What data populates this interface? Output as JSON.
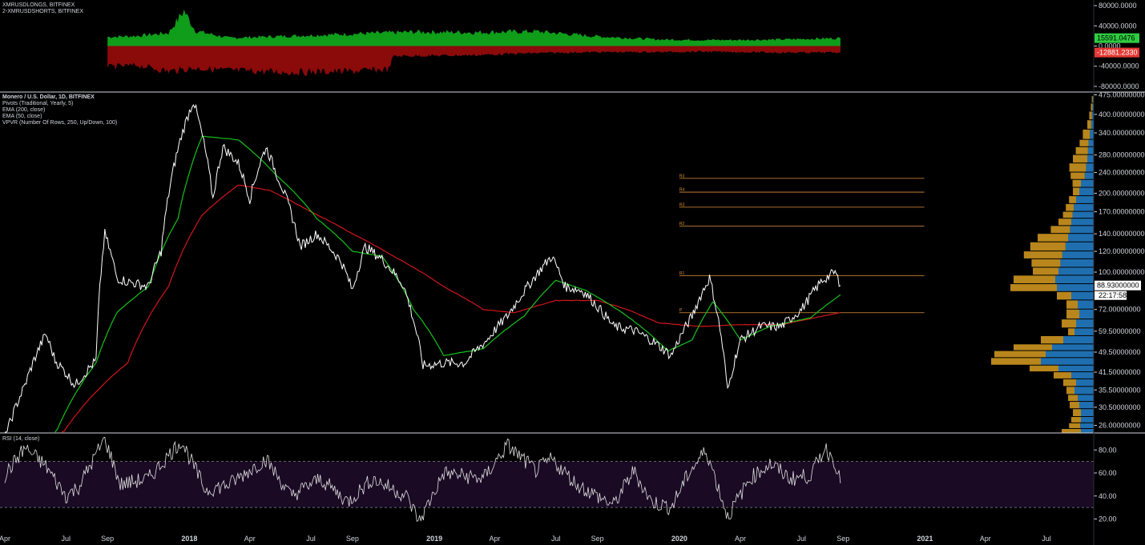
{
  "legends": {
    "top": [
      "XMRUSDLONGS, BITFINEX",
      "2-XMRUSDSHORTS, BITFINEX"
    ],
    "main": [
      "Monero / U.S. Dollar, 1D, BITFINEX",
      "Pivots (Traditional, Yearly, 5)",
      "EMA (200, close)",
      "EMA (50, close)",
      "VPVR (Number Of Rows, 250, Up/Down, 100)"
    ],
    "rsi": "RSI (14, close)"
  },
  "colors": {
    "longs": "#0f9d1a",
    "shorts": "#8b0a0a",
    "price": "#ffffff",
    "ema200": "#d3161b",
    "ema50": "#16c21a",
    "pivot": "#e0913a",
    "vpvr_up": "#1f6fb0",
    "vpvr_down": "#b8861c",
    "rsi_line": "#e0e0e0",
    "rsi_band": "#1a0a24",
    "badge_longs": "#2ecc40",
    "badge_shorts": "#e53935"
  },
  "chart_data": [
    {
      "id": "positions",
      "type": "area",
      "yticks": [
        "80000.0000",
        "40000.0000",
        "0.0000",
        "-40000.0000",
        "-80000.0000"
      ],
      "tick_values": [
        80000,
        40000,
        0,
        -40000,
        -80000
      ],
      "ylim": [
        -88000,
        88000
      ],
      "series": [
        {
          "name": "XMRUSDLONGS",
          "last_label": "15591.0476",
          "x": [
            "2017-09-01",
            "2017-10-15",
            "2017-12-01",
            "2017-12-24",
            "2018-01-10",
            "2018-03-01",
            "2018-06-01",
            "2018-09-01",
            "2018-12-01",
            "2019-03-01",
            "2019-06-01",
            "2019-09-01",
            "2019-12-01",
            "2020-02-01",
            "2020-04-01",
            "2020-06-01",
            "2020-08-28"
          ],
          "values": [
            18000,
            20000,
            26000,
            70000,
            30000,
            16000,
            20000,
            24000,
            28000,
            27000,
            29000,
            19000,
            13000,
            12000,
            12000,
            13000,
            15591
          ]
        },
        {
          "name": "XMRUSDSHORTS",
          "last_label": "-12881.2330",
          "x": [
            "2017-09-01",
            "2017-10-15",
            "2017-12-01",
            "2018-01-10",
            "2018-03-01",
            "2018-06-01",
            "2018-09-01",
            "2018-10-25",
            "2018-11-01",
            "2019-03-01",
            "2019-06-01",
            "2019-09-01",
            "2019-12-01",
            "2020-02-01",
            "2020-04-01",
            "2020-06-01",
            "2020-08-28"
          ],
          "values": [
            -42000,
            -38000,
            -50000,
            -44000,
            -48000,
            -52000,
            -50000,
            -46000,
            -20000,
            -18000,
            -14000,
            -12000,
            -12000,
            -11000,
            -12000,
            -13000,
            -12881
          ]
        }
      ]
    },
    {
      "id": "price",
      "type": "line",
      "scale": "log",
      "yticks": [
        "475.00000000",
        "400.00000000",
        "340.00000000",
        "280.00000000",
        "240.00000000",
        "200.00000000",
        "170.00000000",
        "140.00000000",
        "120.00000000",
        "100.00000000",
        "88.93000000",
        "72.00000000",
        "59.50000000",
        "49.50000000",
        "41.50000000",
        "35.50000000",
        "30.50000000",
        "26.00000000"
      ],
      "tick_values": [
        475,
        400,
        340,
        280,
        240,
        200,
        170,
        140,
        120,
        100,
        72,
        59.5,
        49.5,
        41.5,
        35.5,
        30.5,
        26
      ],
      "ylim": [
        24.5,
        480
      ],
      "last_price": 88.93,
      "last_price_label": "88.93000000",
      "countdown": "22:17:58",
      "pivots": [
        {
          "label": "R3",
          "value": 228
        },
        {
          "label": "R4",
          "value": 202
        },
        {
          "label": "R3",
          "value": 177
        },
        {
          "label": "R2",
          "value": 150
        },
        {
          "label": "R1",
          "value": 97
        },
        {
          "label": "P",
          "value": 70
        }
      ],
      "series": [
        {
          "name": "Monero / U.S. Dollar",
          "x": [
            "2017-04-01",
            "2017-05-01",
            "2017-06-01",
            "2017-06-15",
            "2017-07-15",
            "2017-08-15",
            "2017-08-28",
            "2017-09-15",
            "2017-10-01",
            "2017-11-01",
            "2017-11-20",
            "2017-12-20",
            "2018-01-07",
            "2018-02-05",
            "2018-02-20",
            "2018-03-15",
            "2018-04-01",
            "2018-04-25",
            "2018-05-10",
            "2018-06-15",
            "2018-07-10",
            "2018-08-15",
            "2018-09-01",
            "2018-09-20",
            "2018-10-15",
            "2018-11-15",
            "2018-12-15",
            "2019-01-15",
            "2019-02-15",
            "2019-03-20",
            "2019-04-20",
            "2019-05-20",
            "2019-06-25",
            "2019-07-15",
            "2019-08-10",
            "2019-09-25",
            "2019-10-25",
            "2019-11-20",
            "2019-12-20",
            "2020-01-20",
            "2020-02-15",
            "2020-03-13",
            "2020-04-01",
            "2020-05-01",
            "2020-06-01",
            "2020-07-01",
            "2020-08-01",
            "2020-08-20",
            "2020-08-28"
          ],
          "values": [
            23,
            37,
            58,
            46,
            37,
            46,
            140,
            95,
            92,
            88,
            120,
            330,
            450,
            190,
            300,
            260,
            190,
            300,
            240,
            125,
            140,
            110,
            85,
            125,
            112,
            90,
            44,
            45,
            45,
            55,
            68,
            88,
            115,
            88,
            85,
            62,
            60,
            55,
            48,
            68,
            95,
            35,
            55,
            62,
            62,
            72,
            93,
            100,
            88.93
          ]
        },
        {
          "name": "EMA (50, close)",
          "x": [
            "2017-06-15",
            "2017-08-15",
            "2017-09-15",
            "2017-11-01",
            "2017-12-15",
            "2018-01-20",
            "2018-03-15",
            "2018-05-10",
            "2018-07-10",
            "2018-09-01",
            "2018-10-15",
            "2018-12-01",
            "2019-01-15",
            "2019-03-15",
            "2019-05-15",
            "2019-07-01",
            "2019-08-15",
            "2019-10-15",
            "2019-12-15",
            "2020-01-20",
            "2020-02-20",
            "2020-04-01",
            "2020-05-15",
            "2020-07-15",
            "2020-08-28"
          ],
          "values": [
            24,
            45,
            70,
            88,
            160,
            330,
            320,
            235,
            160,
            120,
            115,
            72,
            48,
            51,
            68,
            93,
            85,
            68,
            50,
            55,
            77,
            55,
            62,
            67,
            82
          ]
        },
        {
          "name": "EMA (200, close)",
          "x": [
            "2017-06-25",
            "2017-10-01",
            "2017-12-01",
            "2018-01-20",
            "2018-03-15",
            "2018-05-01",
            "2018-07-01",
            "2018-09-01",
            "2018-11-01",
            "2019-01-15",
            "2019-03-15",
            "2019-05-01",
            "2019-07-01",
            "2019-09-01",
            "2019-10-15",
            "2019-12-01",
            "2020-02-01",
            "2020-04-01",
            "2020-06-01",
            "2020-08-28"
          ],
          "values": [
            24,
            45,
            88,
            165,
            215,
            205,
            170,
            140,
            115,
            88,
            72,
            70,
            78,
            78,
            72,
            64,
            62,
            63,
            63,
            70
          ]
        }
      ]
    },
    {
      "id": "rsi",
      "type": "line",
      "yticks": [
        "80.00",
        "60.00",
        "40.00",
        "20.00"
      ],
      "tick_values": [
        80,
        60,
        40,
        20
      ],
      "ylim": [
        12,
        92
      ],
      "band": [
        30,
        70
      ],
      "series": [
        {
          "name": "RSI (14, close)",
          "x": [
            "2017-04-01",
            "2017-05-01",
            "2017-06-01",
            "2017-07-01",
            "2017-07-20",
            "2017-08-28",
            "2017-09-20",
            "2017-11-01",
            "2017-12-20",
            "2018-01-25",
            "2018-03-01",
            "2018-04-25",
            "2018-06-01",
            "2018-07-15",
            "2018-08-25",
            "2018-10-01",
            "2018-11-20",
            "2018-12-10",
            "2019-01-15",
            "2019-03-15",
            "2019-04-20",
            "2019-06-01",
            "2019-06-25",
            "2019-08-01",
            "2019-09-25",
            "2019-10-25",
            "2019-11-20",
            "2019-12-20",
            "2020-01-15",
            "2020-02-10",
            "2020-03-13",
            "2020-04-15",
            "2020-05-15",
            "2020-06-15",
            "2020-07-15",
            "2020-08-05",
            "2020-08-20",
            "2020-08-28"
          ],
          "values": [
            58,
            82,
            66,
            40,
            48,
            90,
            50,
            55,
            88,
            45,
            50,
            72,
            40,
            55,
            35,
            55,
            40,
            18,
            60,
            55,
            84,
            62,
            72,
            50,
            32,
            62,
            35,
            30,
            60,
            80,
            22,
            55,
            68,
            55,
            58,
            82,
            70,
            51
          ]
        }
      ]
    }
  ],
  "vpvr": {
    "rows": [
      {
        "price": 470,
        "up": 3,
        "down": 3
      },
      {
        "price": 440,
        "up": 4,
        "down": 5
      },
      {
        "price": 410,
        "up": 6,
        "down": 8
      },
      {
        "price": 380,
        "up": 8,
        "down": 12
      },
      {
        "price": 350,
        "up": 12,
        "down": 22
      },
      {
        "price": 320,
        "up": 16,
        "down": 28
      },
      {
        "price": 300,
        "up": 18,
        "down": 38
      },
      {
        "price": 280,
        "up": 20,
        "down": 45
      },
      {
        "price": 260,
        "up": 24,
        "down": 52
      },
      {
        "price": 240,
        "up": 28,
        "down": 44
      },
      {
        "price": 225,
        "up": 40,
        "down": 26
      },
      {
        "price": 210,
        "up": 45,
        "down": 20
      },
      {
        "price": 195,
        "up": 55,
        "down": 22
      },
      {
        "price": 182,
        "up": 62,
        "down": 25
      },
      {
        "price": 170,
        "up": 66,
        "down": 30
      },
      {
        "price": 160,
        "up": 70,
        "down": 40
      },
      {
        "price": 150,
        "up": 74,
        "down": 60
      },
      {
        "price": 140,
        "up": 80,
        "down": 95
      },
      {
        "price": 130,
        "up": 88,
        "down": 110
      },
      {
        "price": 120,
        "up": 98,
        "down": 120
      },
      {
        "price": 112,
        "up": 104,
        "down": 90
      },
      {
        "price": 104,
        "up": 110,
        "down": 80
      },
      {
        "price": 97,
        "up": 120,
        "down": 130
      },
      {
        "price": 90,
        "up": 115,
        "down": 145
      },
      {
        "price": 84,
        "up": 70,
        "down": 45
      },
      {
        "price": 78,
        "up": 50,
        "down": 35
      },
      {
        "price": 72,
        "up": 45,
        "down": 40
      },
      {
        "price": 66,
        "up": 55,
        "down": 45
      },
      {
        "price": 61,
        "up": 60,
        "down": 20
      },
      {
        "price": 57,
        "up": 95,
        "down": 70
      },
      {
        "price": 53,
        "up": 130,
        "down": 120
      },
      {
        "price": 50,
        "up": 150,
        "down": 160
      },
      {
        "price": 47,
        "up": 165,
        "down": 155
      },
      {
        "price": 44,
        "up": 110,
        "down": 90
      },
      {
        "price": 41.5,
        "up": 70,
        "down": 55
      },
      {
        "price": 39,
        "up": 55,
        "down": 40
      },
      {
        "price": 36.5,
        "up": 60,
        "down": 25
      },
      {
        "price": 34,
        "up": 50,
        "down": 30
      },
      {
        "price": 32,
        "up": 45,
        "down": 30
      },
      {
        "price": 30,
        "up": 40,
        "down": 25
      },
      {
        "price": 28,
        "up": 40,
        "down": 30
      },
      {
        "price": 26.5,
        "up": 42,
        "down": 35
      },
      {
        "price": 25.2,
        "up": 40,
        "down": 60
      }
    ]
  },
  "xaxis": {
    "labels": [
      "Apr",
      "Jul",
      "Sep",
      "2018",
      "Apr",
      "Jul",
      "Sep",
      "2019",
      "Apr",
      "Jul",
      "Sep",
      "2020",
      "Apr",
      "Jul",
      "Sep",
      "2021",
      "Apr",
      "Jul"
    ],
    "dates": [
      "2017-04-01",
      "2017-07-01",
      "2017-09-01",
      "2018-01-01",
      "2018-04-01",
      "2018-07-01",
      "2018-09-01",
      "2019-01-01",
      "2019-04-01",
      "2019-07-01",
      "2019-09-01",
      "2020-01-01",
      "2020-04-01",
      "2020-07-01",
      "2020-09-01",
      "2021-01-01",
      "2021-04-01",
      "2021-07-01"
    ],
    "bold": [
      false,
      false,
      false,
      true,
      false,
      false,
      false,
      true,
      false,
      false,
      false,
      true,
      false,
      false,
      false,
      true,
      false,
      false
    ]
  }
}
